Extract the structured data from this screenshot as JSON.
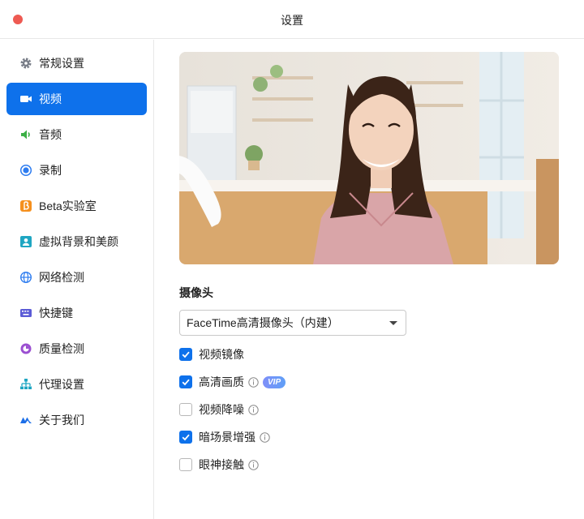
{
  "window": {
    "title": "设置"
  },
  "sidebar": {
    "items": [
      {
        "label": "常规设置",
        "icon": "gear-icon",
        "active": false
      },
      {
        "label": "视频",
        "icon": "video-camera-icon",
        "active": true
      },
      {
        "label": "音频",
        "icon": "speaker-icon",
        "active": false
      },
      {
        "label": "录制",
        "icon": "record-icon",
        "active": false
      },
      {
        "label": "Beta实验室",
        "icon": "beta-icon",
        "active": false
      },
      {
        "label": "虚拟背景和美颜",
        "icon": "portrait-icon",
        "active": false
      },
      {
        "label": "网络检测",
        "icon": "globe-icon",
        "active": false
      },
      {
        "label": "快捷键",
        "icon": "keyboard-icon",
        "active": false
      },
      {
        "label": "质量检测",
        "icon": "quality-icon",
        "active": false
      },
      {
        "label": "代理设置",
        "icon": "network-tree-icon",
        "active": false
      },
      {
        "label": "关于我们",
        "icon": "brand-logo-icon",
        "active": false
      }
    ]
  },
  "video": {
    "camera_label": "摄像头",
    "camera_selected": "FaceTime高清摄像头（内建）",
    "options": [
      {
        "label": "视频镜像",
        "checked": true,
        "info": false,
        "badge": ""
      },
      {
        "label": "高清画质",
        "checked": true,
        "info": true,
        "badge": "VIP"
      },
      {
        "label": "视频降噪",
        "checked": false,
        "info": true,
        "badge": ""
      },
      {
        "label": "暗场景增强",
        "checked": true,
        "info": true,
        "badge": ""
      },
      {
        "label": "眼神接触",
        "checked": false,
        "info": true,
        "badge": ""
      }
    ]
  },
  "colors": {
    "accent": "#0e71eb",
    "close": "#ee5a52",
    "vip_start": "#7f8ff8",
    "vip_end": "#5f9ff7"
  }
}
